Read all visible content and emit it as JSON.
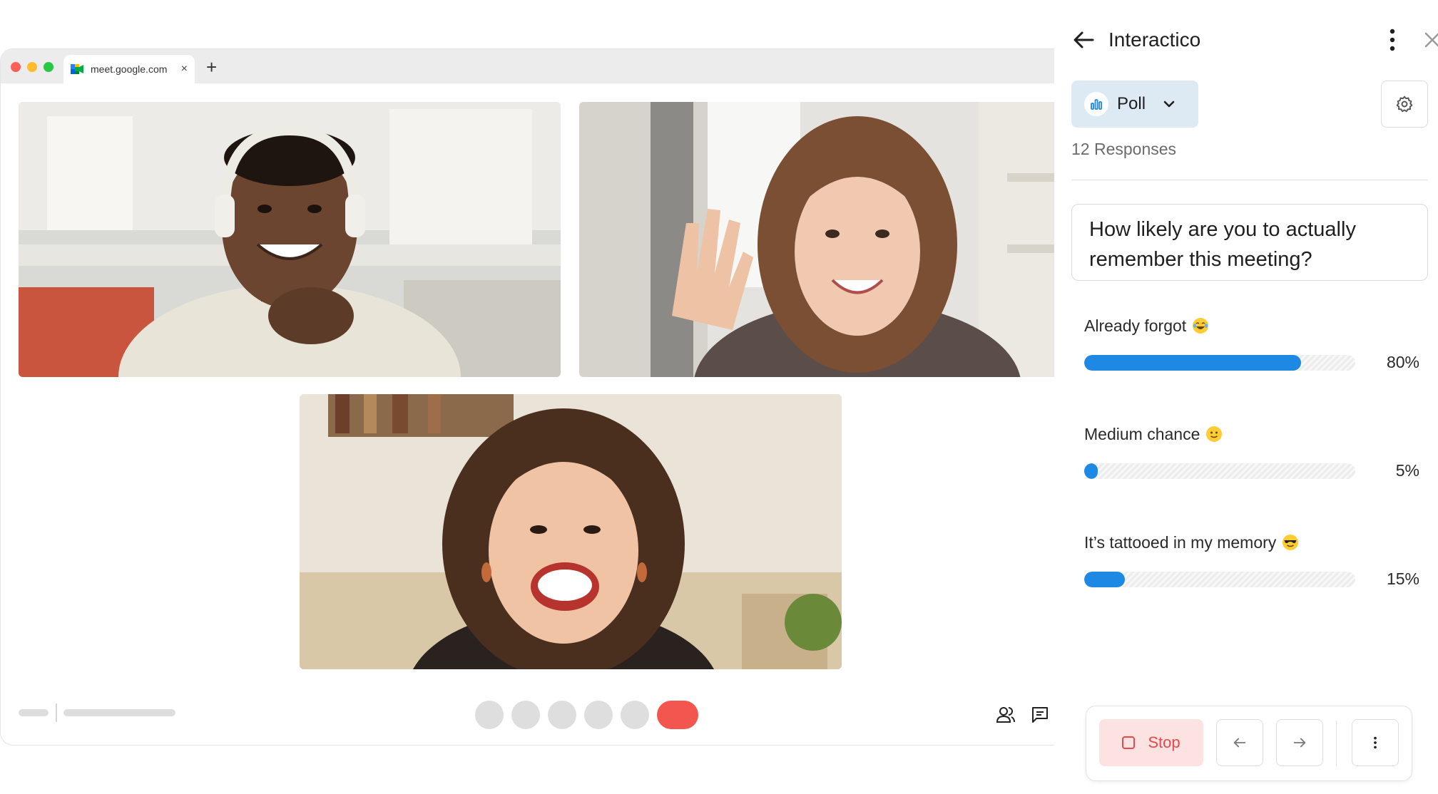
{
  "browser": {
    "tab_url": "meet.google.com",
    "tab_close": "×",
    "new_tab": "+"
  },
  "meet": {
    "participants": [
      "participant-1",
      "participant-2",
      "participant-3"
    ]
  },
  "panel": {
    "title": "Interactico",
    "activity_type": "Poll",
    "responses": "12 Responses",
    "question": "How likely are you to actually remember this meeting?",
    "options": [
      {
        "label": "Already forgot",
        "emoji": "laughing-tears-emoji",
        "percent_label": "80%",
        "percent": 80
      },
      {
        "label": "Medium chance",
        "emoji": "slight-smile-emoji",
        "percent_label": "5%",
        "percent": 5
      },
      {
        "label": "It’s tattooed in my memory",
        "emoji": "sunglasses-emoji",
        "percent_label": "15%",
        "percent": 15
      }
    ],
    "stop_label": "Stop"
  },
  "colors": {
    "accent": "#1e88e5",
    "poll_chip": "#dde9f3",
    "stop_bg": "#fde2e2",
    "stop_text": "#e5484d",
    "end_call": "#f2564f"
  }
}
